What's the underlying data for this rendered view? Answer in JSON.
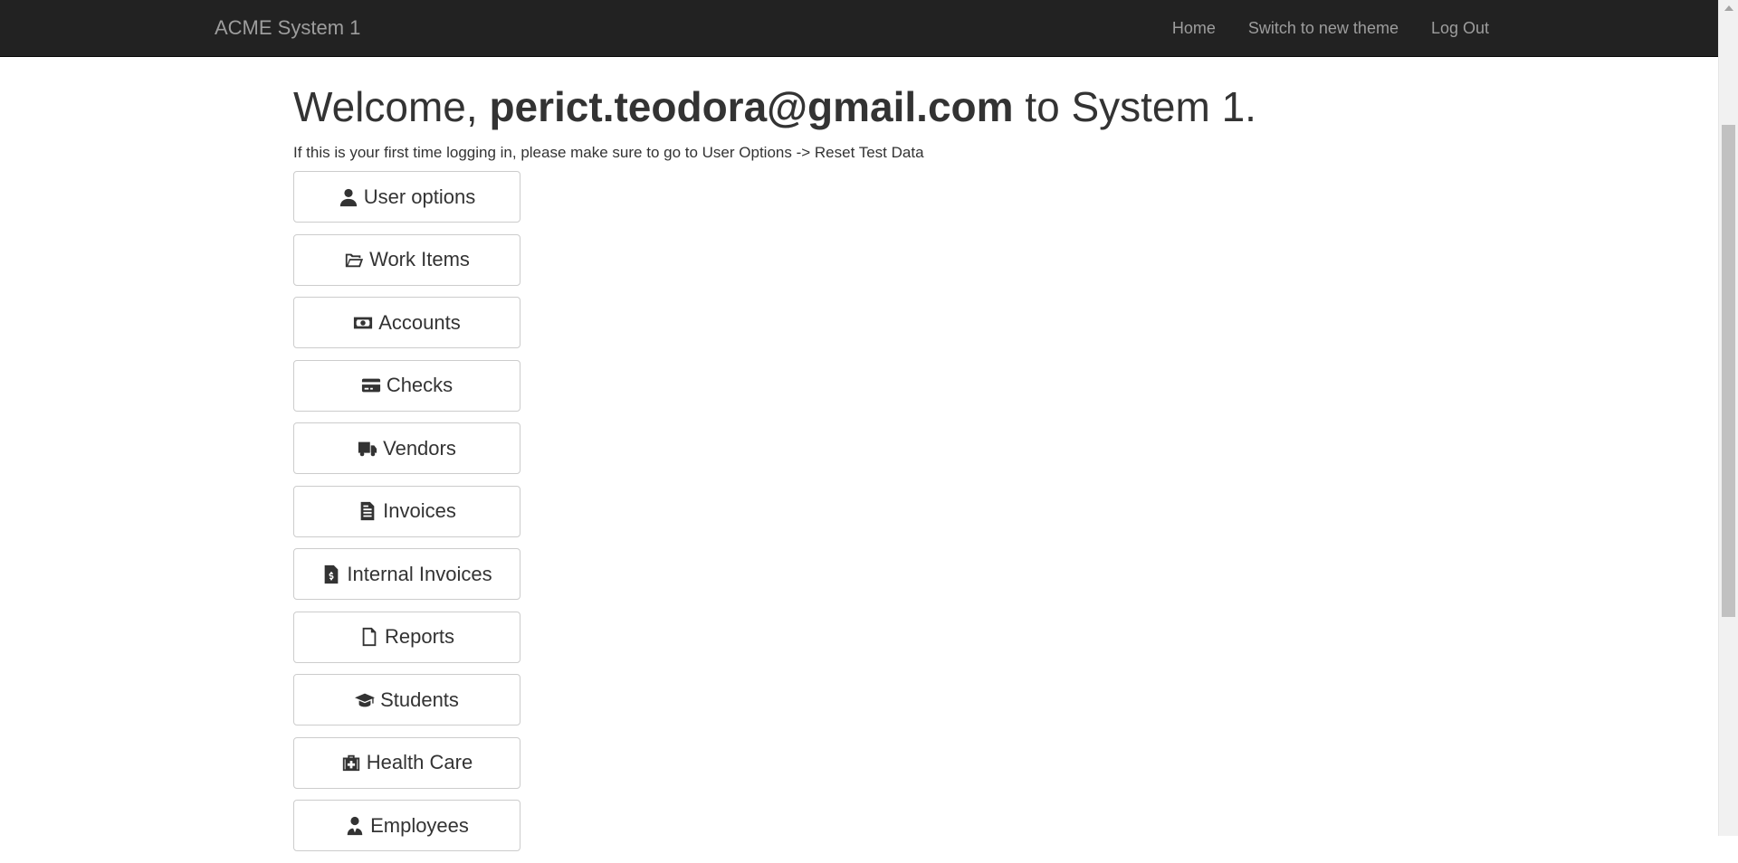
{
  "navbar": {
    "brand": "ACME System 1",
    "links": [
      "Home",
      "Switch to new theme",
      "Log Out"
    ]
  },
  "welcome": {
    "prefix": "Welcome,",
    "email": "perict.teodora@gmail.com",
    "suffix": "to System 1."
  },
  "hint": "If this is your first time logging in, please make sure to go to User Options -> Reset Test Data",
  "menu": {
    "items": [
      {
        "label": "User options",
        "icon": "user-icon"
      },
      {
        "label": "Work Items",
        "icon": "folder-open-icon"
      },
      {
        "label": "Accounts",
        "icon": "money-bill-icon"
      },
      {
        "label": "Checks",
        "icon": "credit-card-icon"
      },
      {
        "label": "Vendors",
        "icon": "truck-icon"
      },
      {
        "label": "Invoices",
        "icon": "file-text-icon"
      },
      {
        "label": "Internal Invoices",
        "icon": "file-invoice-dollar-icon"
      },
      {
        "label": "Reports",
        "icon": "file-icon"
      },
      {
        "label": "Students",
        "icon": "graduation-cap-icon"
      },
      {
        "label": "Health Care",
        "icon": "medkit-icon"
      },
      {
        "label": "Employees",
        "icon": "user-tie-icon"
      }
    ]
  },
  "colors": {
    "navbar_bg": "#222222",
    "nav_text": "#9d9d9d",
    "button_border": "#cccccc",
    "text": "#333333"
  }
}
